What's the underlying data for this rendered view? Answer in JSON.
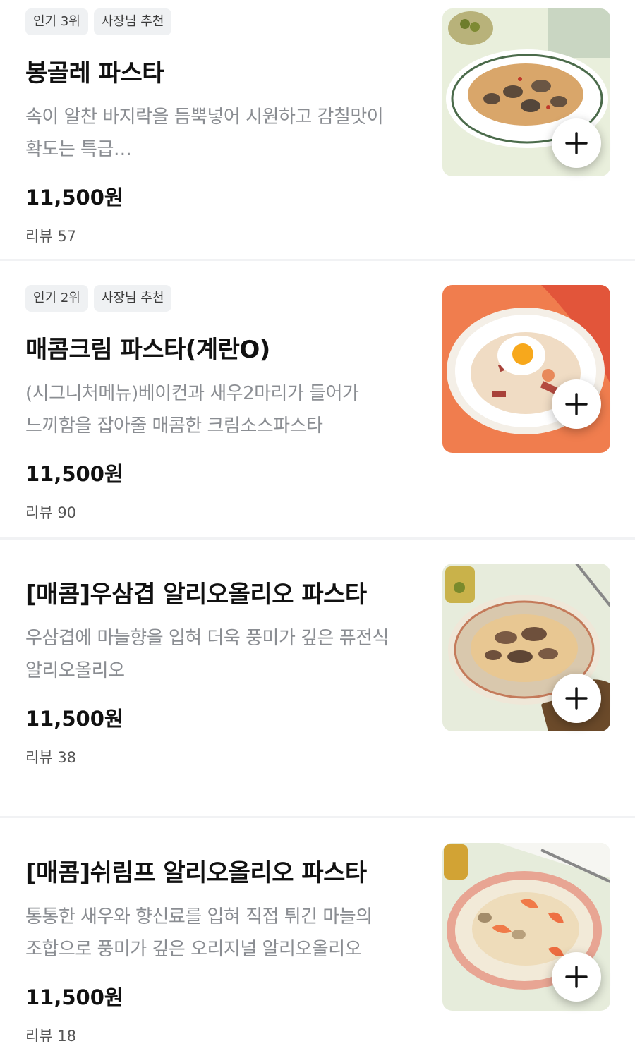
{
  "menu": {
    "items": [
      {
        "badges": [
          "인기 3위",
          "사장님 추천"
        ],
        "name": "봉골레 파스타",
        "description": "속이 알찬 바지락을 듬뿍넣어 시원하고 감칠맛이 확도는 특급…",
        "price": "11,500원",
        "review": "리뷰 57",
        "image_icon": "vongole-pasta-photo"
      },
      {
        "badges": [
          "인기 2위",
          "사장님 추천"
        ],
        "name": "매콤크림 파스타(계란O)",
        "description": "(시그니처메뉴)베이컨과 새우2마리가 들어가 느끼함을 잡아줄 매콤한 크림소스파스타",
        "price": "11,500원",
        "review": "리뷰 90",
        "image_icon": "spicy-cream-pasta-photo"
      },
      {
        "badges": [],
        "name": "[매콤]우삼겹 알리오올리오 파스타",
        "description": "우삼겹에 마늘향을 입혀 더욱 풍미가 깊은 퓨전식 알리오올리오",
        "price": "11,500원",
        "review": "리뷰 38",
        "image_icon": "beef-aglio-olio-photo"
      },
      {
        "badges": [],
        "name": "[매콤]쉬림프 알리오올리오 파스타",
        "description": "통통한 새우와 향신료를 입혀 직접 튀긴 마늘의 조합으로 풍미가 깊은 오리지널 알리오올리오",
        "price": "11,500원",
        "review": "리뷰 18",
        "image_icon": "shrimp-aglio-olio-photo"
      }
    ]
  },
  "add_icon": "plus-icon",
  "colors": {
    "badge_bg": "#eff1f3",
    "description": "#8a8d92",
    "divider": "#f1f2f4"
  }
}
